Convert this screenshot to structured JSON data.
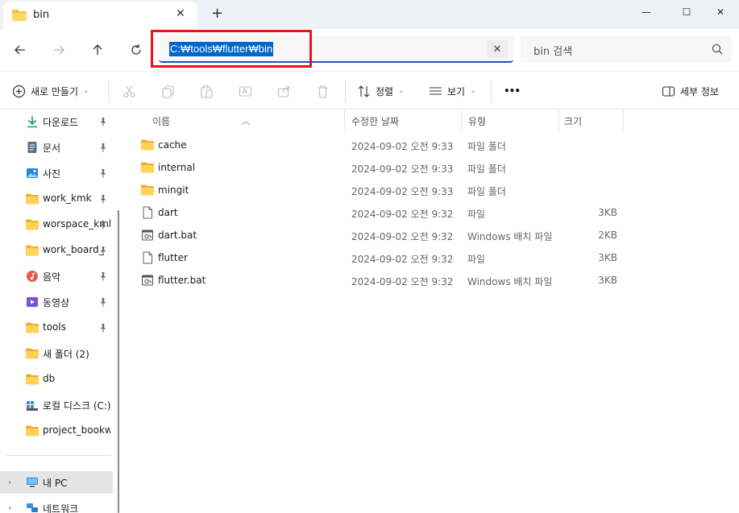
{
  "window": {
    "tab_title": "bin",
    "tab_close": "✕",
    "new_tab": "+",
    "minimize": "—",
    "maximize": "☐",
    "close": "✕"
  },
  "address": {
    "path": "C:₩tools₩flutter₩bin",
    "clear": "✕",
    "search_placeholder": "bin 검색",
    "highlight_color": "#e8161b",
    "selection_color": "#0066cc"
  },
  "toolbar": {
    "new_label": "새로 만들기",
    "sort_label": "정렬",
    "view_label": "보기",
    "more_label": "•••",
    "details_label": "세부 정보"
  },
  "sidebar": {
    "items": [
      {
        "label": "다운로드",
        "icon": "download-icon",
        "pinned": true
      },
      {
        "label": "문서",
        "icon": "document-icon",
        "pinned": true
      },
      {
        "label": "사진",
        "icon": "pictures-icon",
        "pinned": true
      },
      {
        "label": "work_kmk",
        "icon": "folder-icon",
        "pinned": true
      },
      {
        "label": "worspace_kmk",
        "icon": "folder-icon",
        "pinned": true
      },
      {
        "label": "work_board_",
        "icon": "folder-icon",
        "pinned": true
      },
      {
        "label": "음악",
        "icon": "music-icon",
        "pinned": true
      },
      {
        "label": "동영상",
        "icon": "video-icon",
        "pinned": true
      },
      {
        "label": "tools",
        "icon": "folder-icon",
        "pinned": true
      },
      {
        "label": "새 폴더 (2)",
        "icon": "folder-icon",
        "pinned": false
      },
      {
        "label": "db",
        "icon": "folder-icon",
        "pinned": false
      },
      {
        "label": "로컬 디스크 (C:)",
        "icon": "drive-icon",
        "pinned": false
      },
      {
        "label": "project_bookwa",
        "icon": "folder-icon",
        "pinned": false
      }
    ],
    "this_pc": "내 PC",
    "network": "네트워크"
  },
  "filelist": {
    "columns": [
      "이름",
      "수정한 날짜",
      "유형",
      "크기"
    ],
    "rows": [
      {
        "name": "cache",
        "date": "2024-09-02 오전 9:33",
        "type": "파일 폴더",
        "size": "",
        "icon": "folder-icon"
      },
      {
        "name": "internal",
        "date": "2024-09-02 오전 9:33",
        "type": "파일 폴더",
        "size": "",
        "icon": "folder-icon"
      },
      {
        "name": "mingit",
        "date": "2024-09-02 오전 9:33",
        "type": "파일 폴더",
        "size": "",
        "icon": "folder-icon"
      },
      {
        "name": "dart",
        "date": "2024-09-02 오전 9:32",
        "type": "파일",
        "size": "3KB",
        "icon": "file-icon"
      },
      {
        "name": "dart.bat",
        "date": "2024-09-02 오전 9:32",
        "type": "Windows 배치 파일",
        "size": "2KB",
        "icon": "batch-file-icon"
      },
      {
        "name": "flutter",
        "date": "2024-09-02 오전 9:32",
        "type": "파일",
        "size": "3KB",
        "icon": "file-icon"
      },
      {
        "name": "flutter.bat",
        "date": "2024-09-02 오전 9:32",
        "type": "Windows 배치 파일",
        "size": "3KB",
        "icon": "batch-file-icon"
      }
    ]
  }
}
